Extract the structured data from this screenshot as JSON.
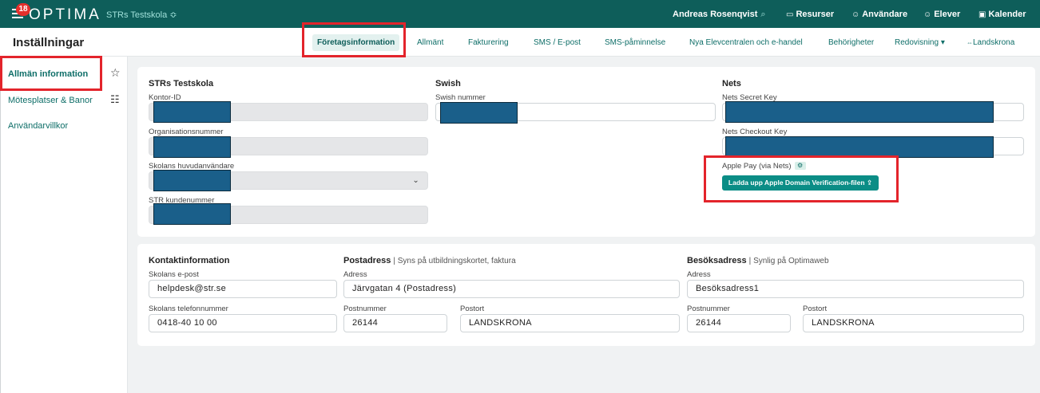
{
  "topbar": {
    "notifications": "18",
    "logo": "OPTIMA",
    "school": "STRs Testskola ≎",
    "user": "Andreas Rosenqvist",
    "nav": [
      {
        "label": "Resurser",
        "icon": "briefcase-icon"
      },
      {
        "label": "Användare",
        "icon": "user-icon"
      },
      {
        "label": "Elever",
        "icon": "users-icon"
      },
      {
        "label": "Kalender",
        "icon": "calendar-icon"
      }
    ]
  },
  "subbar": {
    "title": "Inställningar",
    "tabs": [
      "Företagsinformation",
      "Allmänt",
      "Fakturering",
      "SMS / E-post",
      "SMS-påminnelse",
      "Nya Elevcentralen och e-handel",
      "Behörigheter",
      "Redovisning ▾",
      "Landskrona"
    ]
  },
  "sidebar": {
    "items": [
      "Allmän information",
      "Mötesplatser & Banor",
      "Användarvillkor"
    ]
  },
  "company": {
    "name": "STRs Testskola",
    "kontor_label": "Kontor-ID",
    "org_label": "Organisationsnummer",
    "huvud_label": "Skolans huvudanvändare",
    "kund_label": "STR kundenummer",
    "swish_title": "Swish",
    "swish_label": "Swish nummer",
    "nets_title": "Nets",
    "nets_secret_label": "Nets Secret Key",
    "nets_checkout_label": "Nets Checkout Key",
    "apple_label": "Apple Pay (via Nets)",
    "upload_label": "Ladda upp Apple Domain Verification-filen"
  },
  "contact": {
    "title": "Kontaktinformation",
    "email_label": "Skolans e-post",
    "email": "helpdesk@str.se",
    "phone_label": "Skolans telefonnummer",
    "phone": "0418-40 10 00"
  },
  "postal": {
    "title": "Postadress",
    "subtitle": "Syns på utbildningskortet, faktura",
    "address_label": "Adress",
    "address": "Järvgatan 4 (Postadress)",
    "zip_label": "Postnummer",
    "zip": "26144",
    "city_label": "Postort",
    "city": "LANDSKRONA"
  },
  "visit": {
    "title": "Besöksadress",
    "subtitle": "Synlig på Optimaweb",
    "address_label": "Adress",
    "address": "Besöksadress1",
    "zip_label": "Postnummer",
    "zip": "26144",
    "city_label": "Postort",
    "city": "LANDSKRONA"
  },
  "colors": {
    "brand": "#0e5e5a",
    "accent": "#0b8d86",
    "highlight": "#e3242b"
  }
}
